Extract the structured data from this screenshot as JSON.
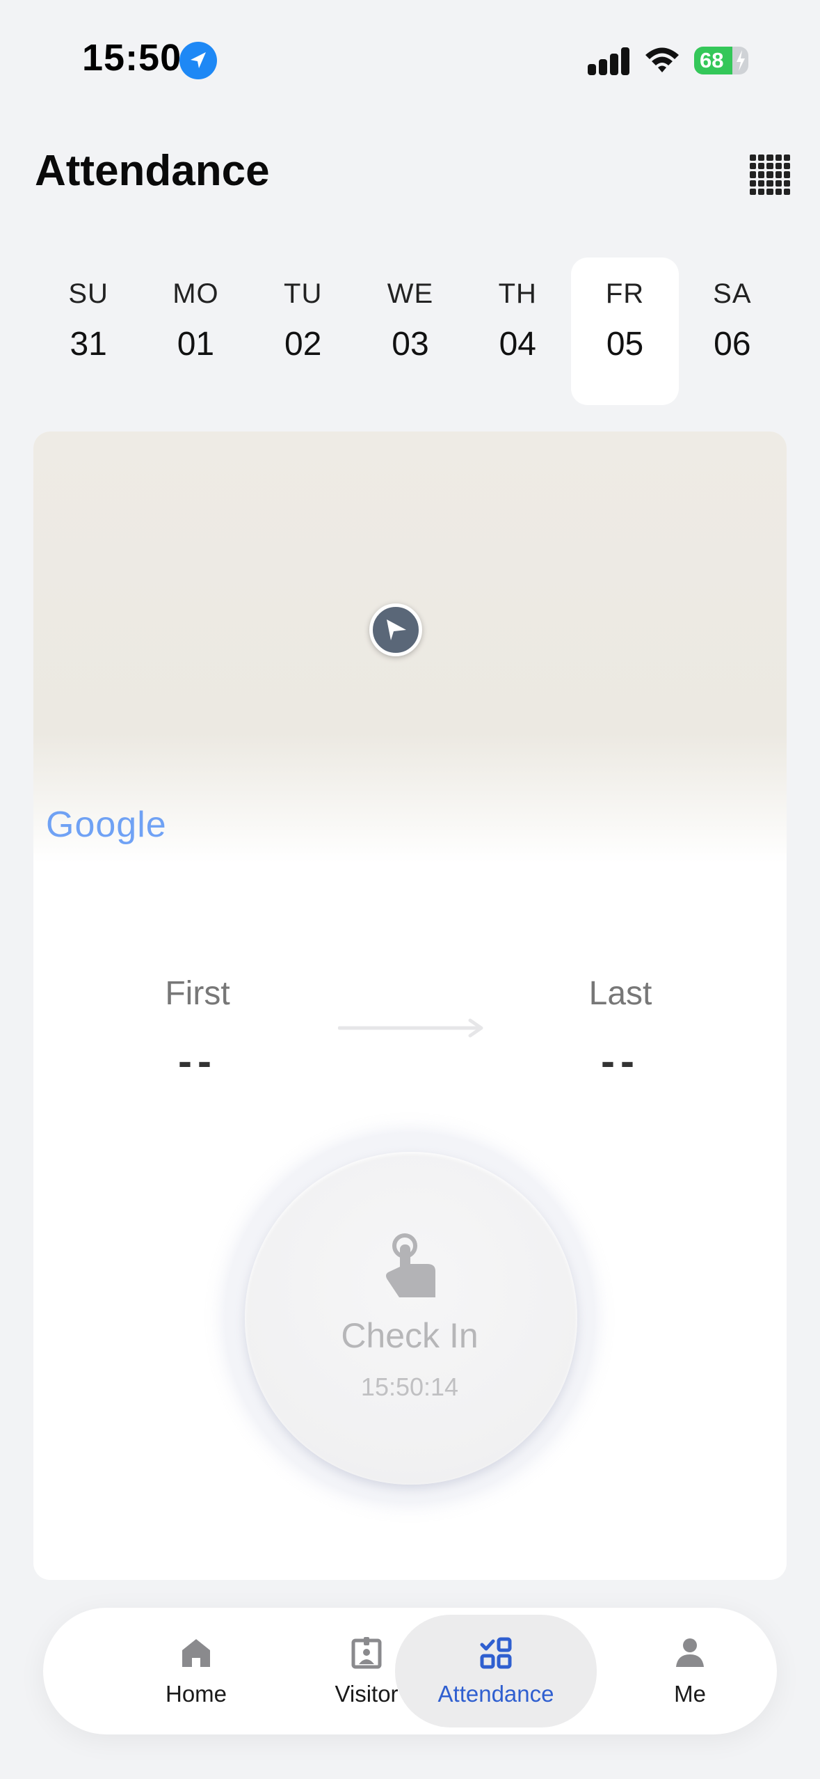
{
  "status_bar": {
    "time": "15:50",
    "battery": "68"
  },
  "header": {
    "title": "Attendance"
  },
  "week": [
    {
      "dow": "SU",
      "date": "31",
      "selected": false
    },
    {
      "dow": "MO",
      "date": "01",
      "selected": false
    },
    {
      "dow": "TU",
      "date": "02",
      "selected": false
    },
    {
      "dow": "WE",
      "date": "03",
      "selected": false
    },
    {
      "dow": "TH",
      "date": "04",
      "selected": false
    },
    {
      "dow": "FR",
      "date": "05",
      "selected": true
    },
    {
      "dow": "SA",
      "date": "06",
      "selected": false
    }
  ],
  "map": {
    "attribution": "Google"
  },
  "punch": {
    "first_label": "First",
    "first_value": "--",
    "last_label": "Last",
    "last_value": "--"
  },
  "check_in": {
    "label": "Check In",
    "time": "15:50:14"
  },
  "tabs": [
    {
      "label": "Home",
      "icon": "home-icon",
      "active": false
    },
    {
      "label": "Visitor",
      "icon": "visitor-badge-icon",
      "active": false
    },
    {
      "label": "Attendance",
      "icon": "attendance-icon",
      "active": true
    },
    {
      "label": "Me",
      "icon": "person-icon",
      "active": false
    }
  ],
  "colors": {
    "accent": "#2f5fd0",
    "battery": "#34c759",
    "location": "#1e88f5"
  }
}
